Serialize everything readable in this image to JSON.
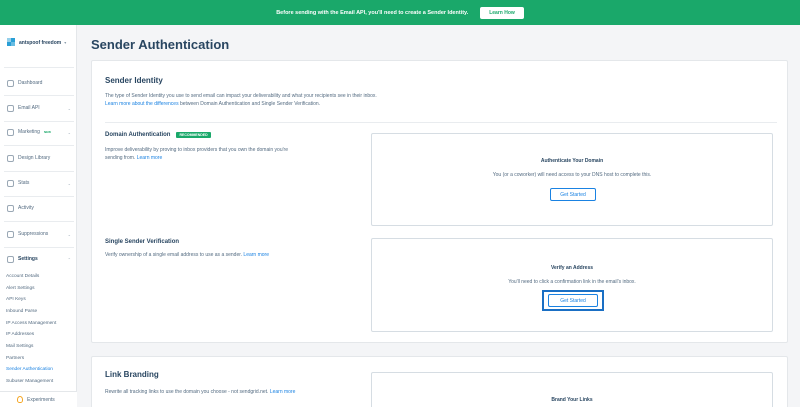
{
  "banner": {
    "text": "Before sending with the Email API, you'll need to create a Sender Identity.",
    "button": "Learn How"
  },
  "sidebar": {
    "account_name": "antspoof freedom",
    "nav": [
      {
        "label": "Dashboard",
        "icon": "dashboard-icon"
      },
      {
        "label": "Email API",
        "icon": "email-api-icon"
      },
      {
        "label": "Marketing",
        "icon": "marketing-icon",
        "badge": "NEW"
      },
      {
        "label": "Design Library",
        "icon": "design-library-icon"
      },
      {
        "label": "Stats",
        "icon": "stats-icon"
      },
      {
        "label": "Activity",
        "icon": "activity-icon"
      },
      {
        "label": "Suppressions",
        "icon": "suppressions-icon"
      },
      {
        "label": "Settings",
        "icon": "settings-icon"
      }
    ],
    "settings_items": [
      "Account Details",
      "Alert Settings",
      "API Keys",
      "Inbound Parse",
      "IP Access Management",
      "IP Addresses",
      "Mail Settings",
      "Partners",
      "Sender Authentication",
      "Subuser Management"
    ],
    "experiments": "Experiments"
  },
  "main": {
    "title": "Sender Authentication",
    "sender_identity": {
      "title": "Sender Identity",
      "desc": "The type of Sender Identity you use to send email can impact your deliverability and what your recipients see in their inbox.",
      "link": "Learn more about the differences",
      "link_tail": " between Domain Authentication and Single Sender Verification."
    },
    "domain_auth": {
      "title": "Domain Authentication",
      "badge": "RECOMMENDED",
      "desc1": "Improve deliverability by proving to inbox providers that you own the domain you're",
      "desc2": "sending from. ",
      "link": "Learn more",
      "panel_title": "Authenticate Your Domain",
      "panel_desc": "You (or a coworker) will need access to your DNS host to complete this.",
      "button": "Get Started"
    },
    "single_sender": {
      "title": "Single Sender Verification",
      "desc": "Verify ownership of a single email address to use as a sender. ",
      "link": "Learn more",
      "panel_title": "Verify an Address",
      "panel_desc": "You'll need to click a confirmation link in the email's inbox.",
      "button": "Get Started"
    },
    "link_branding": {
      "title": "Link Branding",
      "desc": "Rewrite all tracking links to use the domain you choose - not sendgrid.net. ",
      "link": "Learn more",
      "panel_title": "Brand Your Links"
    }
  }
}
